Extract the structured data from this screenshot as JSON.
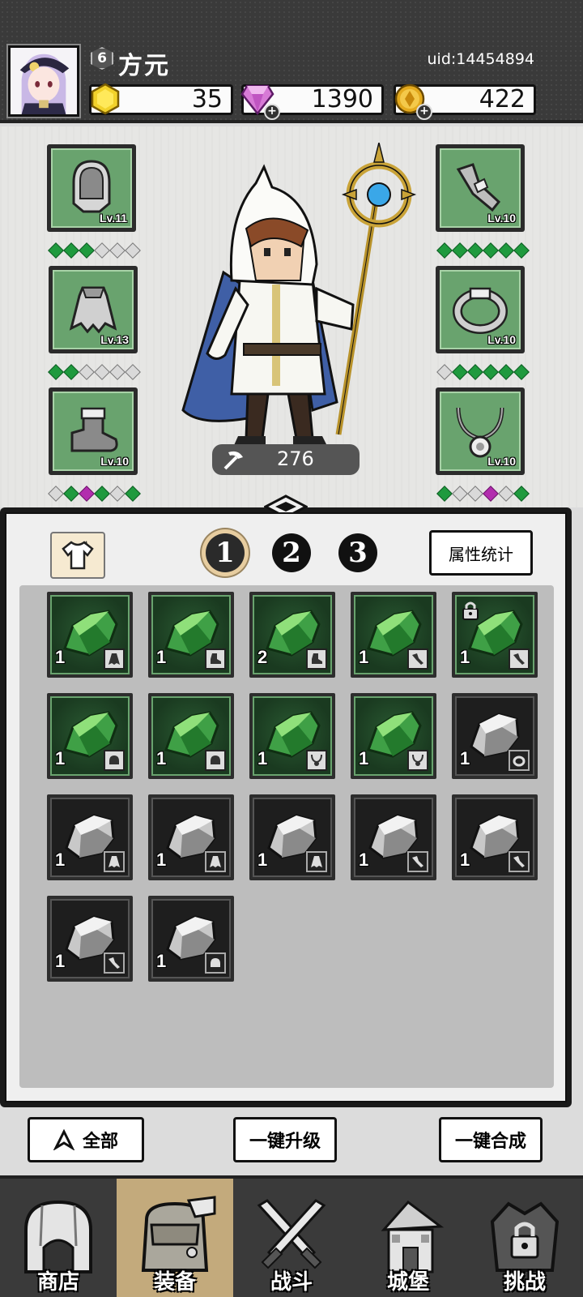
{
  "player": {
    "level": "6",
    "name": "方元",
    "uid": "uid:14454894"
  },
  "resources": {
    "energy": "35",
    "gems": "1390",
    "gold": "422"
  },
  "colors": {
    "slot_green": "#69a36e",
    "gem_green": "#1f9a3e",
    "gem_purple": "#b22dae",
    "active_nav": "#c3aa7c"
  },
  "equipment": {
    "left": [
      {
        "icon": "helmet-icon",
        "level": "Lv.11",
        "gems": [
          "g",
          "g",
          "g",
          "w",
          "w",
          "w"
        ]
      },
      {
        "icon": "cape-icon",
        "level": "Lv.13",
        "gems": [
          "g",
          "g",
          "w",
          "w",
          "w",
          "w"
        ]
      },
      {
        "icon": "boots-icon",
        "level": "Lv.10",
        "gems": [
          "w",
          "g",
          "p",
          "g",
          "w",
          "g"
        ]
      }
    ],
    "right": [
      {
        "icon": "bracer-icon",
        "level": "Lv.10",
        "gems": [
          "g",
          "g",
          "g",
          "g",
          "g",
          "g"
        ]
      },
      {
        "icon": "ring-icon",
        "level": "Lv.10",
        "gems": [
          "w",
          "g",
          "g",
          "g",
          "g",
          "g"
        ]
      },
      {
        "icon": "necklace-icon",
        "level": "Lv.10",
        "gems": [
          "g",
          "w",
          "w",
          "p",
          "w",
          "g"
        ]
      }
    ]
  },
  "power": "276",
  "inventory": {
    "tabs": [
      "1",
      "2",
      "3"
    ],
    "active_tab": "1",
    "stats_button": "属性统计",
    "items": [
      {
        "kind": "green",
        "count": "1",
        "type": "cape-icon"
      },
      {
        "kind": "green",
        "count": "1",
        "type": "boots-icon"
      },
      {
        "kind": "green",
        "count": "2",
        "type": "boots-icon"
      },
      {
        "kind": "green",
        "count": "1",
        "type": "bracer-icon"
      },
      {
        "kind": "green",
        "count": "1",
        "type": "bracer-icon",
        "locked": true
      },
      {
        "kind": "green",
        "count": "1",
        "type": "helmet-icon"
      },
      {
        "kind": "green",
        "count": "1",
        "type": "helmet-icon"
      },
      {
        "kind": "green",
        "count": "1",
        "type": "necklace-icon"
      },
      {
        "kind": "green",
        "count": "1",
        "type": "necklace-icon"
      },
      {
        "kind": "grey",
        "count": "1",
        "type": "ring-icon"
      },
      {
        "kind": "grey",
        "count": "1",
        "type": "cape-icon"
      },
      {
        "kind": "grey",
        "count": "1",
        "type": "cape-icon"
      },
      {
        "kind": "grey",
        "count": "1",
        "type": "cape-icon"
      },
      {
        "kind": "grey",
        "count": "1",
        "type": "bracer-icon"
      },
      {
        "kind": "grey",
        "count": "1",
        "type": "bracer-icon"
      },
      {
        "kind": "grey",
        "count": "1",
        "type": "bracer-icon"
      },
      {
        "kind": "grey",
        "count": "1",
        "type": "helmet-icon"
      }
    ]
  },
  "actions": {
    "filter": "全部",
    "upgrade_all": "一键升级",
    "merge_all": "一键合成"
  },
  "nav": [
    {
      "label": "商店",
      "icon": "shop-icon"
    },
    {
      "label": "装备",
      "icon": "backpack-icon",
      "active": true
    },
    {
      "label": "战斗",
      "icon": "swords-icon"
    },
    {
      "label": "城堡",
      "icon": "castle-icon"
    },
    {
      "label": "挑战",
      "icon": "challenge-lock-icon"
    }
  ]
}
